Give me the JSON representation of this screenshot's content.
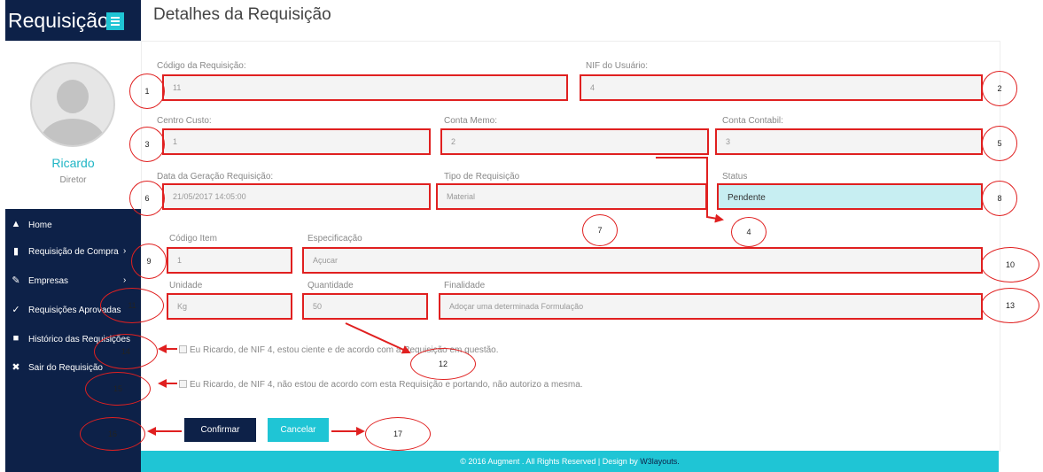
{
  "app": {
    "title": "Requisição"
  },
  "colors": {
    "navy": "#0d2148",
    "accent": "#1fc5d5",
    "annotation": "#e02020"
  },
  "profile": {
    "name": "Ricardo",
    "role": "Diretor"
  },
  "nav": [
    {
      "icon": "home-icon",
      "label": "Home",
      "has_chevron": false
    },
    {
      "icon": "document-icon",
      "label": "Requisição de Compra",
      "has_chevron": true
    },
    {
      "icon": "wrench-icon",
      "label": "Empresas",
      "has_chevron": true
    },
    {
      "icon": "thumbs-up-icon",
      "label": "Requisições Aprovadas",
      "has_chevron": false
    },
    {
      "icon": "book-icon",
      "label": "Histórico das Requisições",
      "has_chevron": false
    },
    {
      "icon": "close-icon",
      "label": "Sair do Requisição",
      "has_chevron": false
    }
  ],
  "page": {
    "title": "Detalhes da Requisição"
  },
  "form": {
    "codigo_requisicao": {
      "label": "Código da Requisição:",
      "value": "11"
    },
    "nif_usuario": {
      "label": "NIF do Usuário:",
      "value": "4"
    },
    "centro_custo": {
      "label": "Centro Custo:",
      "value": "1"
    },
    "conta_memo": {
      "label": "Conta Memo:",
      "value": "2"
    },
    "conta_contabil": {
      "label": "Conta Contabil:",
      "value": "3"
    },
    "data_geracao": {
      "label": "Data da Geração Requisição:",
      "value": "21/05/2017 14:05:00"
    },
    "tipo_requisicao": {
      "label": "Tipo de Requisição",
      "value": "Material"
    },
    "status": {
      "label": "Status",
      "value": "Pendente"
    },
    "codigo_item": {
      "label": "Código Item",
      "value": "1"
    },
    "especificacao": {
      "label": "Especificação",
      "value": "Açucar"
    },
    "unidade": {
      "label": "Unidade",
      "value": "Kg"
    },
    "quantidade": {
      "label": "Quantidade",
      "value": "50"
    },
    "finalidade": {
      "label": "Finalidade",
      "value": "Adoçar uma determinada Formulação"
    }
  },
  "agreement": {
    "agree_text": "Eu Ricardo, de NIF 4, estou ciente e de acordo com a Requisição em questão.",
    "disagree_text": "Eu Ricardo, de NIF 4, não estou de acordo com esta Requisição e portando, não autorizo a mesma."
  },
  "buttons": {
    "confirm": "Confirmar",
    "cancel": "Cancelar"
  },
  "footer": {
    "text": "© 2016 Augment . All Rights Reserved | Design by ",
    "link": "W3layouts."
  },
  "annotations": [
    "1",
    "2",
    "3",
    "4",
    "5",
    "6",
    "7",
    "8",
    "9",
    "10",
    "11",
    "12",
    "13",
    "14",
    "15",
    "16",
    "17"
  ]
}
